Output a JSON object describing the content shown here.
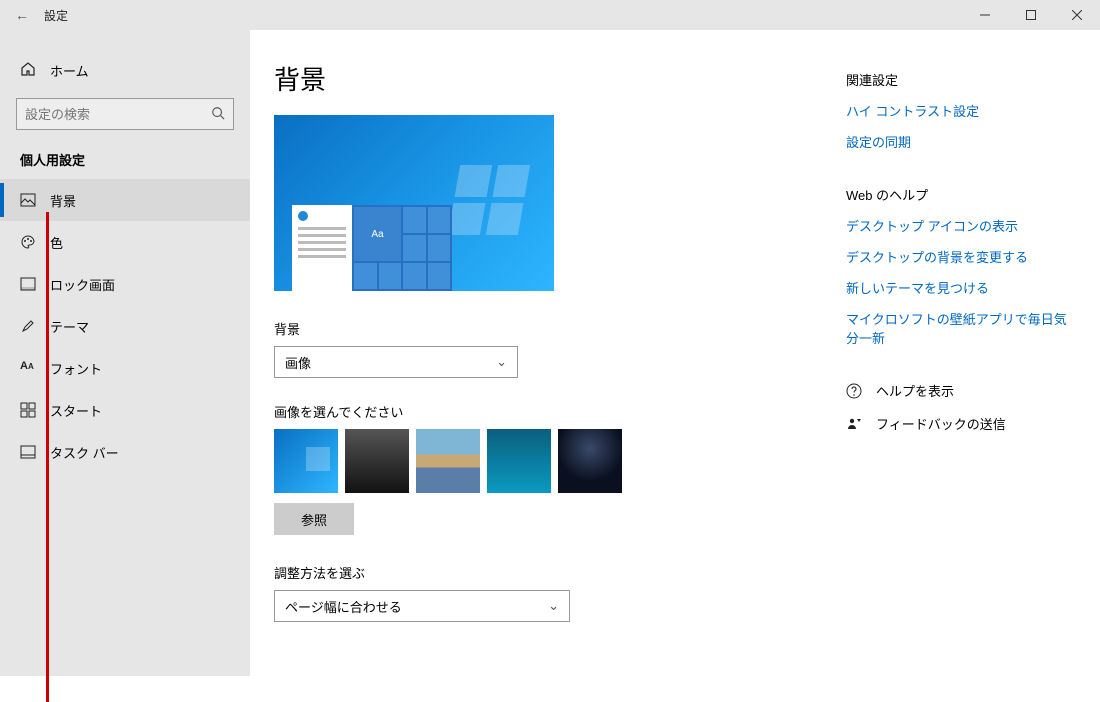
{
  "window": {
    "title": "設定"
  },
  "home_label": "ホーム",
  "search": {
    "placeholder": "設定の検索"
  },
  "section_title": "個人用設定",
  "nav": [
    {
      "key": "background",
      "label": "背景",
      "icon": "picture",
      "selected": true
    },
    {
      "key": "colors",
      "label": "色",
      "icon": "palette"
    },
    {
      "key": "lockscreen",
      "label": "ロック画面",
      "icon": "lock-frame"
    },
    {
      "key": "themes",
      "label": "テーマ",
      "icon": "brush"
    },
    {
      "key": "fonts",
      "label": "フォント",
      "icon": "font"
    },
    {
      "key": "start",
      "label": "スタート",
      "icon": "start-grid"
    },
    {
      "key": "taskbar",
      "label": "タスク バー",
      "icon": "taskbar"
    }
  ],
  "page": {
    "title": "背景",
    "preview_sample": "Aa",
    "bg_label": "背景",
    "bg_value": "画像",
    "choose_label": "画像を選んでください",
    "browse": "参照",
    "fit_label": "調整方法を選ぶ",
    "fit_value": "ページ幅に合わせる"
  },
  "related": {
    "header": "関連設定",
    "links": [
      "ハイ コントラスト設定",
      "設定の同期"
    ]
  },
  "webhelp": {
    "header": "Web のヘルプ",
    "links": [
      "デスクトップ アイコンの表示",
      "デスクトップの背景を変更する",
      "新しいテーマを見つける",
      "マイクロソフトの壁紙アプリで毎日気分一新"
    ]
  },
  "footer": {
    "help": "ヘルプを表示",
    "feedback": "フィードバックの送信"
  }
}
